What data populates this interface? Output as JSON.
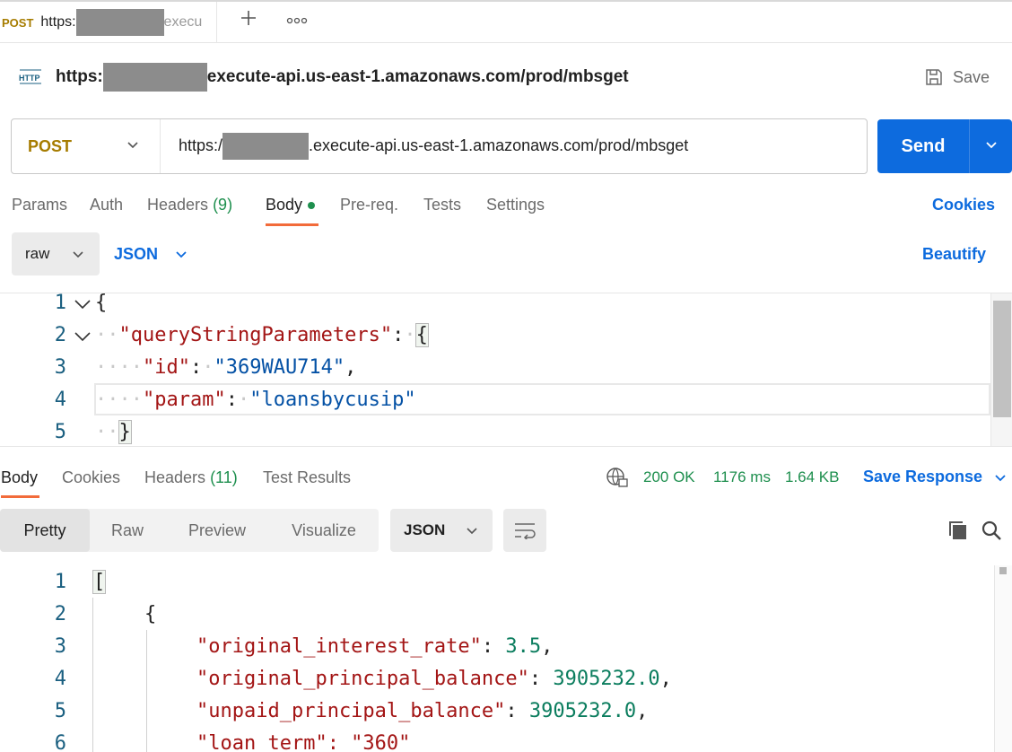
{
  "tab": {
    "method": "POST",
    "url_prefix": "https:",
    "url_suffix": "execu"
  },
  "request": {
    "title_prefix": "https:",
    "title_suffix": "execute-api.us-east-1.amazonaws.com/prod/mbsget",
    "save_label": "Save",
    "method": "POST",
    "url_prefix": "https:/",
    "url_suffix": ".execute-api.us-east-1.amazonaws.com/prod/mbsget",
    "send_label": "Send",
    "tabs": [
      {
        "label": "Params"
      },
      {
        "label": "Auth"
      },
      {
        "label": "Headers",
        "count": "(9)"
      },
      {
        "label": "Body"
      },
      {
        "label": "Pre-req."
      },
      {
        "label": "Tests"
      },
      {
        "label": "Settings"
      }
    ],
    "cookies_label": "Cookies",
    "body_mode": "raw",
    "body_language": "JSON",
    "beautify_label": "Beautify",
    "body_lines": [
      "1",
      "2",
      "3",
      "4",
      "5"
    ],
    "body_code": {
      "open": "{",
      "key1": "\"queryStringParameters\"",
      "key2": "\"id\"",
      "val2": "\"369WAU714\"",
      "key3": "\"param\"",
      "val3": "\"loansbycusip\"",
      "close": "}"
    }
  },
  "response": {
    "tabs": [
      {
        "label": "Body"
      },
      {
        "label": "Cookies"
      },
      {
        "label": "Headers",
        "count": "(11)"
      },
      {
        "label": "Test Results"
      }
    ],
    "status": "200 OK",
    "time": "1176 ms",
    "size": "1.64 KB",
    "save_response_label": "Save Response",
    "views": [
      "Pretty",
      "Raw",
      "Preview",
      "Visualize"
    ],
    "format": "JSON",
    "lines": [
      "1",
      "2",
      "3",
      "4",
      "5",
      "6"
    ],
    "code": {
      "open_bracket": "[",
      "open_brace": "{",
      "f1_key": "\"original_interest_rate\"",
      "f1_val": "3.5",
      "f2_key": "\"original_principal_balance\"",
      "f2_val": "3905232.0",
      "f3_key": "\"unpaid_principal_balance\"",
      "f3_val": "3905232.0",
      "f4_partial": "\"loan_term\": \"360\""
    }
  },
  "colors": {
    "accent": "#0d6bde",
    "method": "#a67c00",
    "success": "#1e8f4e",
    "tab_underline": "#f26b3a"
  }
}
